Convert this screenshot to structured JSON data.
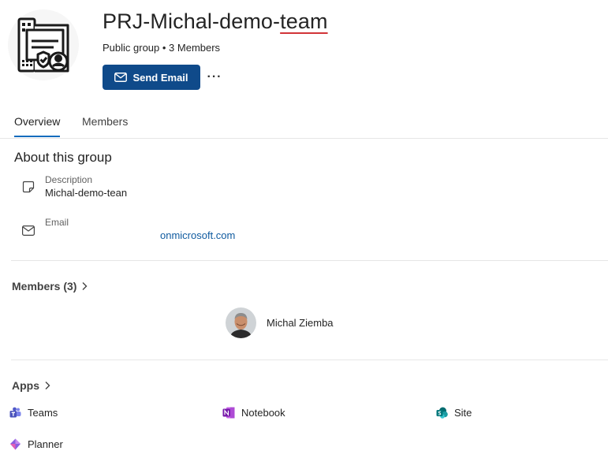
{
  "group": {
    "title_main": "PRJ-Michal-demo-",
    "title_suffix": "team",
    "subtitle": "Public group • 3 Members",
    "send_email_label": "Send Email",
    "more_label": "···"
  },
  "tabs": [
    {
      "label": "Overview",
      "active": true
    },
    {
      "label": "Members",
      "active": false
    }
  ],
  "about": {
    "title": "About this group",
    "description_label": "Description",
    "description_value": "Michal-demo-tean",
    "email_label": "Email",
    "email_value": "onmicrosoft.com"
  },
  "members": {
    "header": "Members (3)",
    "list": [
      {
        "name": "Michal Ziemba"
      }
    ]
  },
  "apps": {
    "header": "Apps",
    "items": [
      {
        "label": "Teams",
        "icon": "teams-icon"
      },
      {
        "label": "Notebook",
        "icon": "onenote-icon"
      },
      {
        "label": "Site",
        "icon": "sharepoint-icon"
      },
      {
        "label": "Planner",
        "icon": "planner-icon"
      }
    ]
  },
  "colors": {
    "primary_button": "#0f4a8a",
    "link": "#0f5a9f",
    "tab_indicator": "#0f6cbd",
    "spellcheck_underline": "#d13438"
  }
}
